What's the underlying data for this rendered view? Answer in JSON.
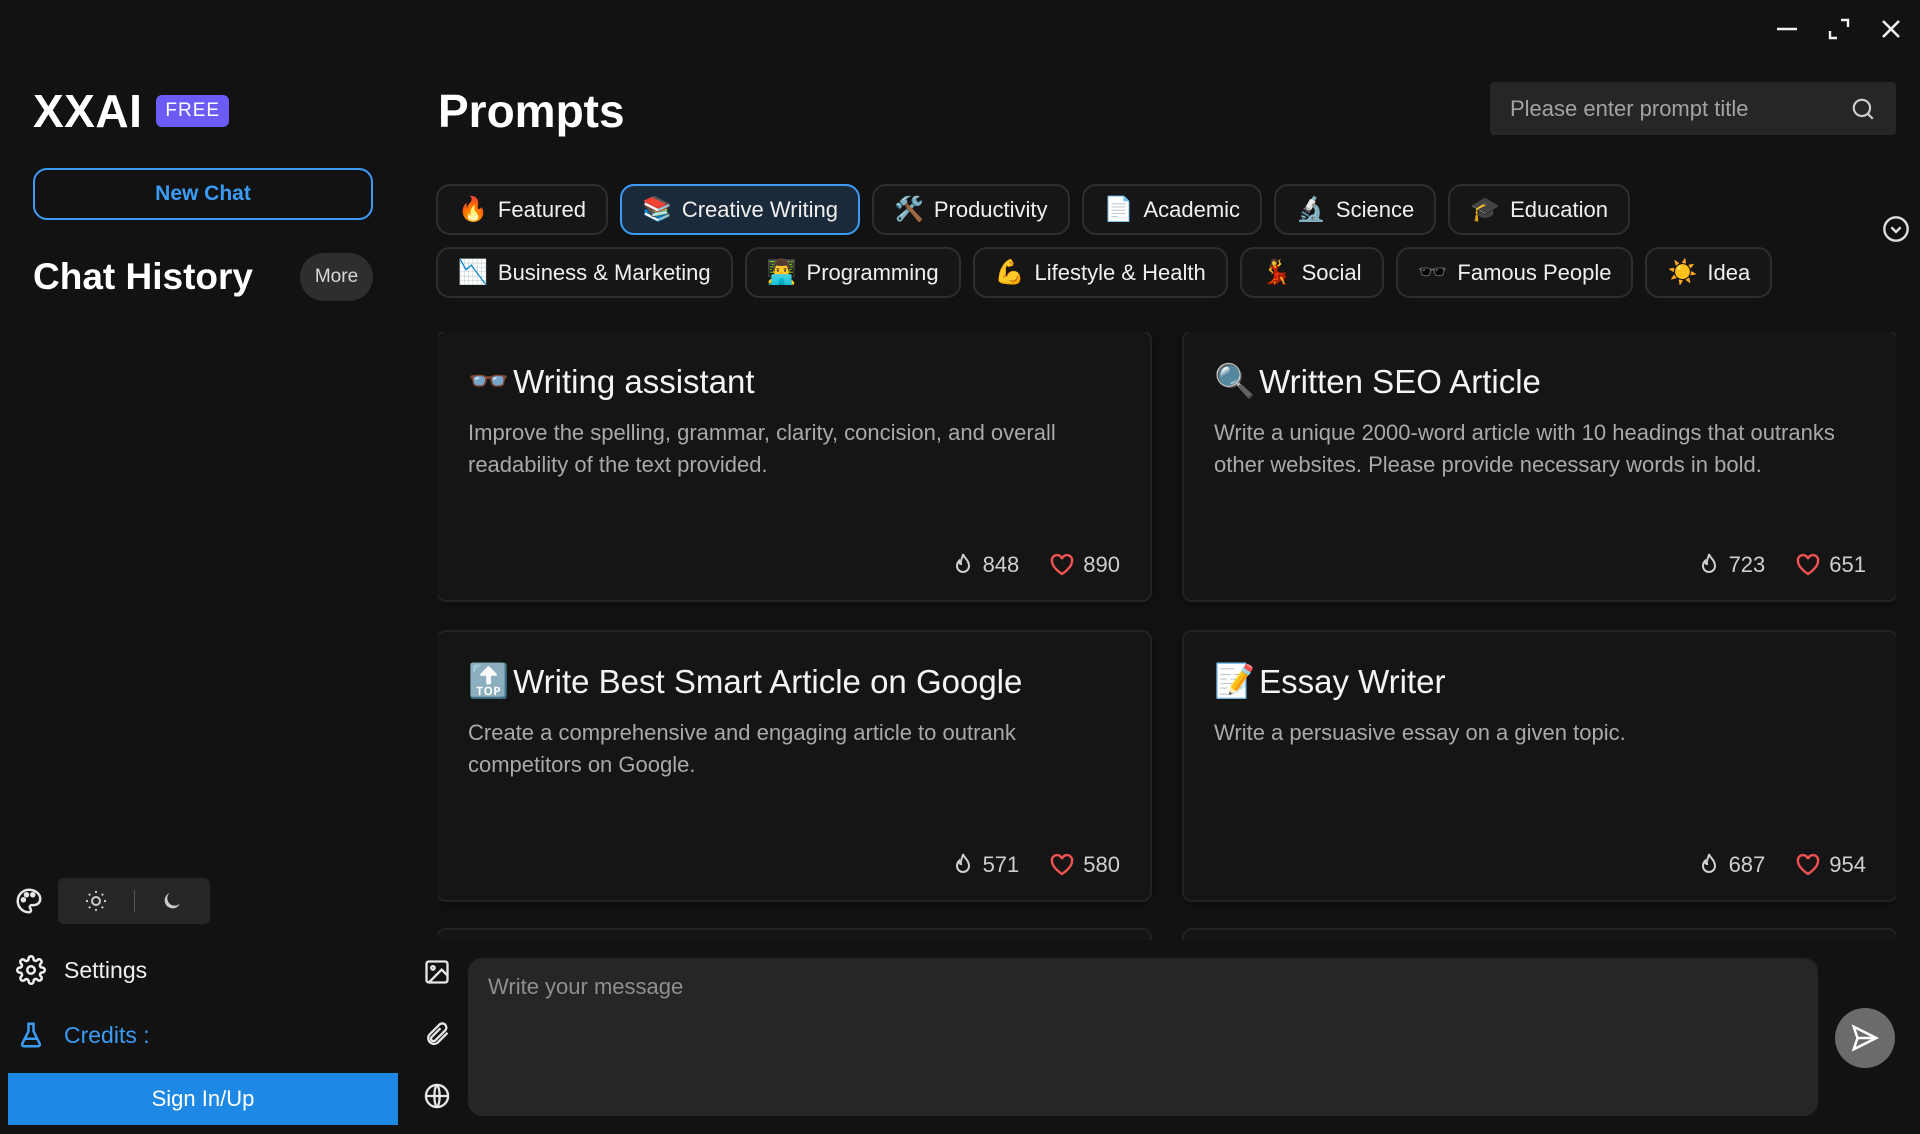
{
  "sidebar": {
    "brand": "XXAI",
    "badge": "FREE",
    "new_chat": "New Chat",
    "history_title": "Chat History",
    "more": "More",
    "settings": "Settings",
    "credits": "Credits :",
    "sign_in": "Sign In/Up"
  },
  "main": {
    "title": "Prompts",
    "search_placeholder": "Please enter prompt title",
    "categories": [
      {
        "emoji": "🔥",
        "label": "Featured"
      },
      {
        "emoji": "📚",
        "label": "Creative Writing",
        "active": true
      },
      {
        "emoji": "🛠️",
        "label": "Productivity"
      },
      {
        "emoji": "📄",
        "label": "Academic"
      },
      {
        "emoji": "🔬",
        "label": "Science"
      },
      {
        "emoji": "🎓",
        "label": "Education"
      },
      {
        "emoji": "📉",
        "label": "Business & Marketing"
      },
      {
        "emoji": "👨‍💻",
        "label": "Programming"
      },
      {
        "emoji": "💪",
        "label": "Lifestyle & Health"
      },
      {
        "emoji": "💃",
        "label": "Social"
      },
      {
        "emoji": "🕶️",
        "label": "Famous People"
      },
      {
        "emoji": "☀️",
        "label": "Idea"
      }
    ],
    "cards": [
      {
        "emoji": "👓",
        "title": "Writing assistant",
        "desc": "Improve the spelling, grammar, clarity, concision, and overall readability of the text provided.",
        "uses": "848",
        "likes": "890"
      },
      {
        "emoji": "🔍",
        "title": "Written SEO Article",
        "desc": "Write a unique 2000-word article with 10 headings that outranks other websites. Please provide necessary words in bold.",
        "uses": "723",
        "likes": "651"
      },
      {
        "emoji": "🔝",
        "title": "Write Best Smart Article on Google",
        "desc": "Create a comprehensive and engaging article to outrank competitors on Google.",
        "uses": "571",
        "likes": "580"
      },
      {
        "emoji": "📝",
        "title": "Essay Writer",
        "desc": "Write a persuasive essay on a given topic.",
        "uses": "687",
        "likes": "954"
      }
    ]
  },
  "composer": {
    "placeholder": "Write your message"
  },
  "colors": {
    "accent": "#3a9cf5",
    "badge": "#6b5cf6",
    "heart": "#f05252",
    "background": "#121212"
  }
}
